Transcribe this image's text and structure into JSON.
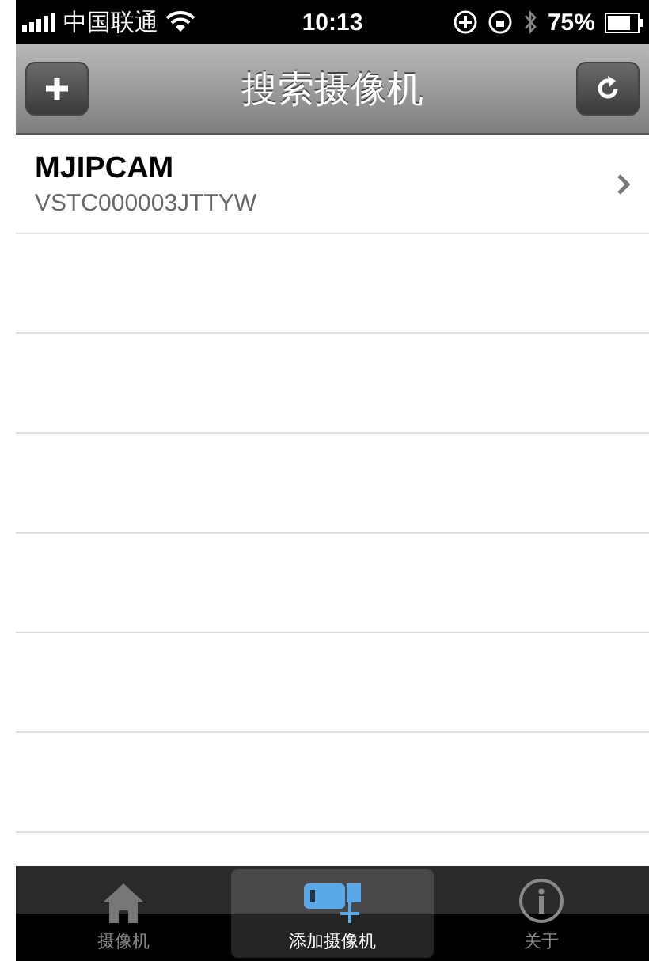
{
  "status_bar": {
    "carrier": "中国联通",
    "time": "10:13",
    "battery": "75%"
  },
  "nav_bar": {
    "title": "搜索摄像机"
  },
  "devices": [
    {
      "name": "MJIPCAM",
      "id": "VSTC000003JTTYW"
    }
  ],
  "tab_bar": [
    {
      "label": "摄像机",
      "kind": "home",
      "selected": false
    },
    {
      "label": "添加摄像机",
      "kind": "camera-add",
      "selected": true
    },
    {
      "label": "关于",
      "kind": "info",
      "selected": false
    }
  ]
}
